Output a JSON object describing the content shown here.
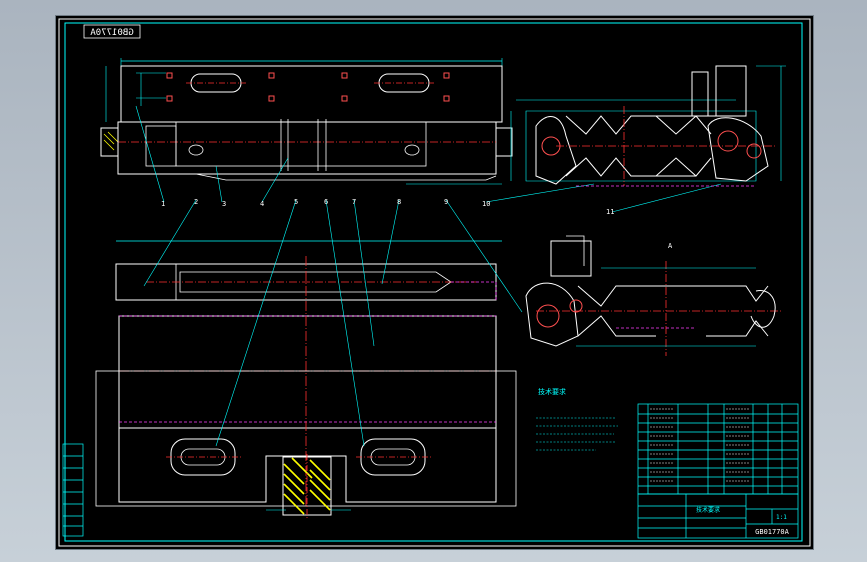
{
  "drawing": {
    "drawing_number_mirrored": "GB01770A",
    "title_code": "GB01770A",
    "scale_text": "1:1",
    "tech_requirements_heading": "技术要求",
    "title_block_caption": "技术要求",
    "view_label_left": "A",
    "view_label_right": "A"
  },
  "part_callouts": [
    "1",
    "2",
    "3",
    "4",
    "5",
    "6",
    "7",
    "8",
    "9",
    "10",
    "11"
  ],
  "colors": {
    "frame": "#00ffff",
    "geometry": "#ffffff",
    "center": "#ff3030",
    "hidden": "#ff40ff",
    "dim": "#00ffff",
    "hatch": "#ffff00",
    "bom": "#00ffff"
  }
}
